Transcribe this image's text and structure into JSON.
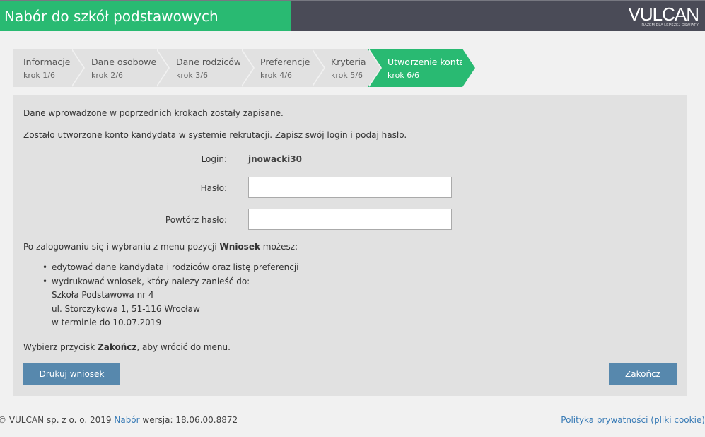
{
  "header": {
    "title": "Nabór do szkół podstawowych",
    "logo_text": "VULCAN",
    "logo_tagline": "RAZEM DLA LEPSZEJ OŚWIATY"
  },
  "steps": [
    {
      "name": "Informacje",
      "sub": "krok 1/6",
      "active": false
    },
    {
      "name": "Dane osobowe",
      "sub": "krok 2/6",
      "active": false
    },
    {
      "name": "Dane rodziców",
      "sub": "krok 3/6",
      "active": false
    },
    {
      "name": "Preferencje",
      "sub": "krok 4/6",
      "active": false
    },
    {
      "name": "Kryteria",
      "sub": "krok 5/6",
      "active": false
    },
    {
      "name": "Utworzenie konta",
      "sub": "krok 6/6",
      "active": true
    }
  ],
  "main": {
    "saved_message": "Dane wprowadzone w poprzednich krokach zostały zapisane.",
    "account_message": "Zostało utworzone konto kandydata w systemie rekrutacji. Zapisz swój login i podaj hasło.",
    "login_label": "Login:",
    "login_value": "jnowacki30",
    "password_label": "Hasło:",
    "password_value": "",
    "repeat_password_label": "Powtórz hasło:",
    "repeat_password_value": "",
    "after_login_prefix": "Po zalogowaniu się i wybraniu z menu pozycji ",
    "after_login_bold": "Wniosek",
    "after_login_suffix": " możesz:",
    "bullets": [
      "edytować dane kandydata i rodziców oraz listę preferencji",
      "wydrukować wniosek, który należy zanieść do:"
    ],
    "school_lines": [
      "Szkoła Podstawowa nr 4",
      "ul. Storczykowa 1, 51-116 Wrocław",
      "w terminie do 10.07.2019"
    ],
    "finish_prefix": "Wybierz przycisk ",
    "finish_bold": "Zakończ",
    "finish_suffix": ", aby wrócić do menu.",
    "print_button": "Drukuj wniosek",
    "finish_button": "Zakończ"
  },
  "footer": {
    "copyright": "© VULCAN sp. z o. o. 2019 ",
    "nabor_link": "Nabór",
    "version": " wersja: 18.06.00.8872",
    "privacy_link": "Polityka prywatności (pliki cookie)"
  },
  "colors": {
    "accent_green": "#29ba72",
    "header_dark": "#4a4b57",
    "button_blue": "#5788ad",
    "link_blue": "#3a7cb6"
  }
}
